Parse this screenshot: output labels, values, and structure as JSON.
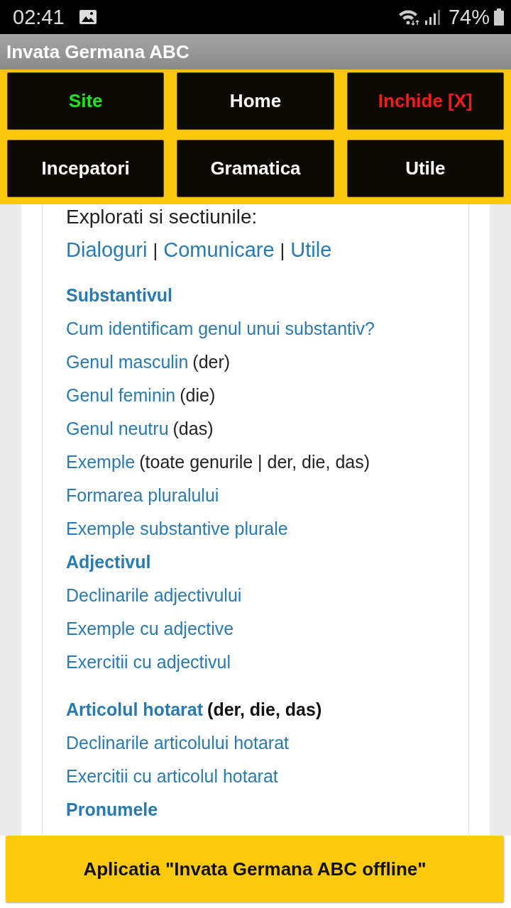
{
  "status_bar": {
    "time": "02:41",
    "battery": "74%"
  },
  "app_bar": {
    "title": "Invata Germana ABC"
  },
  "nav_buttons": [
    {
      "label": "Site",
      "kind": "external"
    },
    {
      "label": "Home",
      "kind": "normal"
    },
    {
      "label": "Inchide [X]",
      "kind": "close"
    },
    {
      "label": "Incepatori",
      "kind": "normal"
    },
    {
      "label": "Gramatica",
      "kind": "normal"
    },
    {
      "label": "Utile",
      "kind": "normal"
    }
  ],
  "intro": {
    "text": "Explorati si sectiunile:",
    "links": [
      "Dialoguri",
      "Comunicare",
      "Utile"
    ],
    "separator": "|"
  },
  "blocks": [
    {
      "sections": [
        {
          "heading": "Substantivul",
          "links": [
            {
              "text": "Cum identificam genul unui substantiv?"
            },
            {
              "text": "Genul masculin",
              "note": "(der)"
            },
            {
              "text": "Genul feminin",
              "note": "(die)"
            },
            {
              "text": "Genul neutru",
              "note": "(das)"
            },
            {
              "text": "Exemple",
              "note": "(toate genurile | der, die, das)"
            },
            {
              "text": "Formarea pluralului"
            },
            {
              "text": "Exemple substantive plurale"
            }
          ]
        },
        {
          "heading": "Adjectivul",
          "links": [
            {
              "text": "Declinarile adjectivului"
            },
            {
              "text": "Exemple cu adjective"
            },
            {
              "text": "Exercitii cu adjectivul"
            }
          ]
        }
      ]
    },
    {
      "sections": [
        {
          "heading": "Articolul hotarat",
          "heading_note": "(der, die, das)",
          "links": [
            {
              "text": "Declinarile articolului hotarat"
            },
            {
              "text": "Exercitii cu articolul hotarat"
            }
          ]
        },
        {
          "heading": "Pronumele"
        }
      ]
    }
  ],
  "banner": {
    "label": "Aplicatia \"Invata Germana ABC offline\""
  }
}
